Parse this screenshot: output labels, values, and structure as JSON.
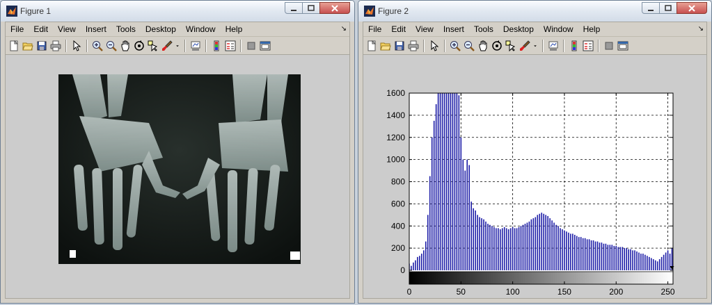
{
  "figure1": {
    "title": "Figure 1",
    "menu": [
      "File",
      "Edit",
      "View",
      "Insert",
      "Tools",
      "Desktop",
      "Window",
      "Help"
    ]
  },
  "figure2": {
    "title": "Figure 2",
    "menu": [
      "File",
      "Edit",
      "View",
      "Insert",
      "Tools",
      "Desktop",
      "Window",
      "Help"
    ]
  },
  "toolbar_icons": [
    "new-figure-icon",
    "open-file-icon",
    "save-icon",
    "print-icon",
    "sep",
    "pointer-icon",
    "sep",
    "zoom-in-icon",
    "zoom-out-icon",
    "pan-icon",
    "rotate-3d-icon",
    "data-cursor-icon",
    "brush-icon",
    "brush-dropdown-icon",
    "sep",
    "link-plot-icon",
    "sep",
    "colorbar-icon",
    "legend-icon",
    "sep",
    "hide-plot-tools-icon",
    "show-plot-tools-icon"
  ],
  "colors": {
    "bar": "#1f1fa8",
    "titlebar": "#dfe7f1",
    "close": "#c75050"
  },
  "chart_data": {
    "type": "bar",
    "title": "",
    "xlabel": "",
    "ylabel": "",
    "xlim": [
      0,
      255
    ],
    "ylim": [
      -100,
      1600
    ],
    "xticks": [
      0,
      50,
      100,
      150,
      200,
      250
    ],
    "yticks": [
      0,
      200,
      400,
      600,
      800,
      1000,
      1200,
      1400,
      1600
    ],
    "grid": true,
    "colorbar": "grayscale 0-255 below axis",
    "x": [
      0,
      2,
      4,
      6,
      8,
      10,
      12,
      14,
      16,
      18,
      20,
      22,
      24,
      26,
      28,
      30,
      32,
      34,
      36,
      38,
      40,
      42,
      44,
      46,
      48,
      50,
      52,
      54,
      56,
      58,
      60,
      62,
      64,
      66,
      68,
      70,
      72,
      74,
      76,
      78,
      80,
      82,
      84,
      86,
      88,
      90,
      92,
      94,
      96,
      98,
      100,
      102,
      104,
      106,
      108,
      110,
      112,
      114,
      116,
      118,
      120,
      122,
      124,
      126,
      128,
      130,
      132,
      134,
      136,
      138,
      140,
      142,
      144,
      146,
      148,
      150,
      152,
      154,
      156,
      158,
      160,
      162,
      164,
      166,
      168,
      170,
      172,
      174,
      176,
      178,
      180,
      182,
      184,
      186,
      188,
      190,
      192,
      194,
      196,
      198,
      200,
      202,
      204,
      206,
      208,
      210,
      212,
      214,
      216,
      218,
      220,
      222,
      224,
      226,
      228,
      230,
      232,
      234,
      236,
      238,
      240,
      242,
      244,
      246,
      248,
      250,
      252,
      254
    ],
    "values": [
      60,
      40,
      70,
      90,
      120,
      130,
      150,
      180,
      260,
      500,
      850,
      1200,
      1350,
      1500,
      1620,
      1700,
      1680,
      1700,
      1650,
      1700,
      1680,
      1650,
      1620,
      1600,
      1580,
      1200,
      1000,
      900,
      1000,
      950,
      620,
      560,
      540,
      500,
      480,
      470,
      460,
      440,
      420,
      410,
      400,
      390,
      380,
      380,
      370,
      380,
      390,
      380,
      370,
      380,
      390,
      380,
      380,
      390,
      400,
      410,
      420,
      430,
      440,
      460,
      470,
      480,
      500,
      510,
      520,
      510,
      500,
      490,
      470,
      450,
      430,
      410,
      400,
      380,
      370,
      360,
      350,
      340,
      330,
      330,
      320,
      310,
      300,
      300,
      290,
      290,
      280,
      280,
      270,
      270,
      260,
      260,
      250,
      250,
      240,
      240,
      230,
      230,
      230,
      220,
      220,
      210,
      210,
      210,
      200,
      200,
      190,
      190,
      180,
      180,
      170,
      160,
      150,
      150,
      140,
      130,
      120,
      110,
      100,
      90,
      80,
      100,
      120,
      140,
      160,
      180,
      150,
      200
    ]
  }
}
